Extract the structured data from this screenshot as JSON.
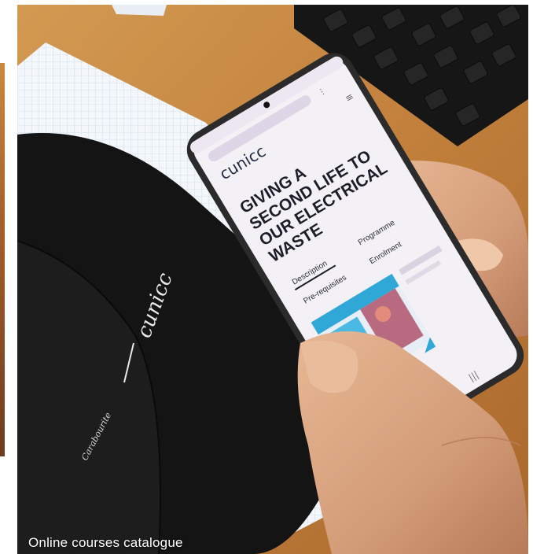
{
  "caption": "Online courses catalogue",
  "phone_screen": {
    "logo": "cunicc",
    "headline_lines": [
      "GIVING A",
      "SECOND LIFE TO",
      "OUR ELECTRICAL",
      "WASTE"
    ],
    "tabs": [
      "Description",
      "Programme",
      "Pre-requisites",
      "Enrolment"
    ]
  },
  "cap": {
    "brand": "cunicc",
    "script_text": "Carabourite"
  },
  "colors": {
    "desk": "#c8843f",
    "cap": "#171717",
    "phone_body": "#2b2b2b",
    "screen": "#f4f1f6",
    "accent": "#2fa8d8"
  }
}
